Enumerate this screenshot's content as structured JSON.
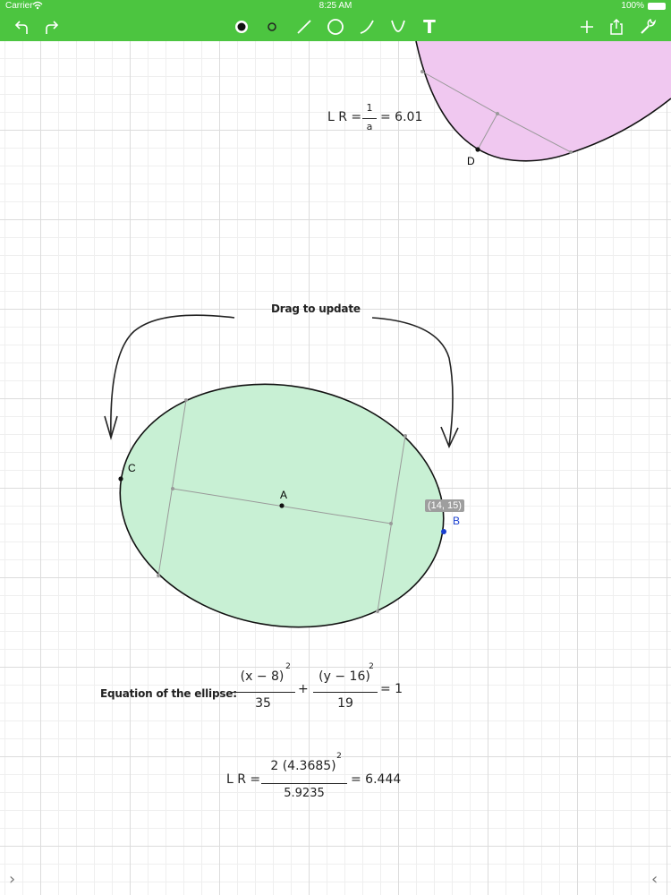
{
  "status": {
    "carrier": "Carrier",
    "time": "8:25 AM",
    "battery": "100%"
  },
  "toolbar": {
    "text_tool": "T"
  },
  "colors": {
    "accent": "#4cc540",
    "ellipse_fill": "#c8f0d4",
    "top_fill": "#f0c8f0",
    "point_blue": "#1a3fd0"
  },
  "top_shape": {
    "point_d": "D",
    "lr_label": "L R =",
    "frac_num": "1",
    "frac_den": "a",
    "lr_value": "= 6.01"
  },
  "ellipse": {
    "drag_note": "Drag to update",
    "point_a": "A",
    "point_b": "B",
    "point_c": "C",
    "coord_tag": "(14, 15)"
  },
  "equation": {
    "label": "Equation of the ellipse:",
    "num1": "(x − 8)",
    "exp1": "2",
    "den1": "35",
    "plus": "+",
    "num2": "(y − 16)",
    "exp2": "2",
    "den2": "19",
    "rhs": "= 1"
  },
  "lr_bottom": {
    "label": "L R =",
    "num": "2 (4.3685)",
    "exp": "2",
    "den": "5.9235",
    "value": "= 6.444"
  },
  "nav": {
    "left": "›",
    "right": "‹"
  }
}
